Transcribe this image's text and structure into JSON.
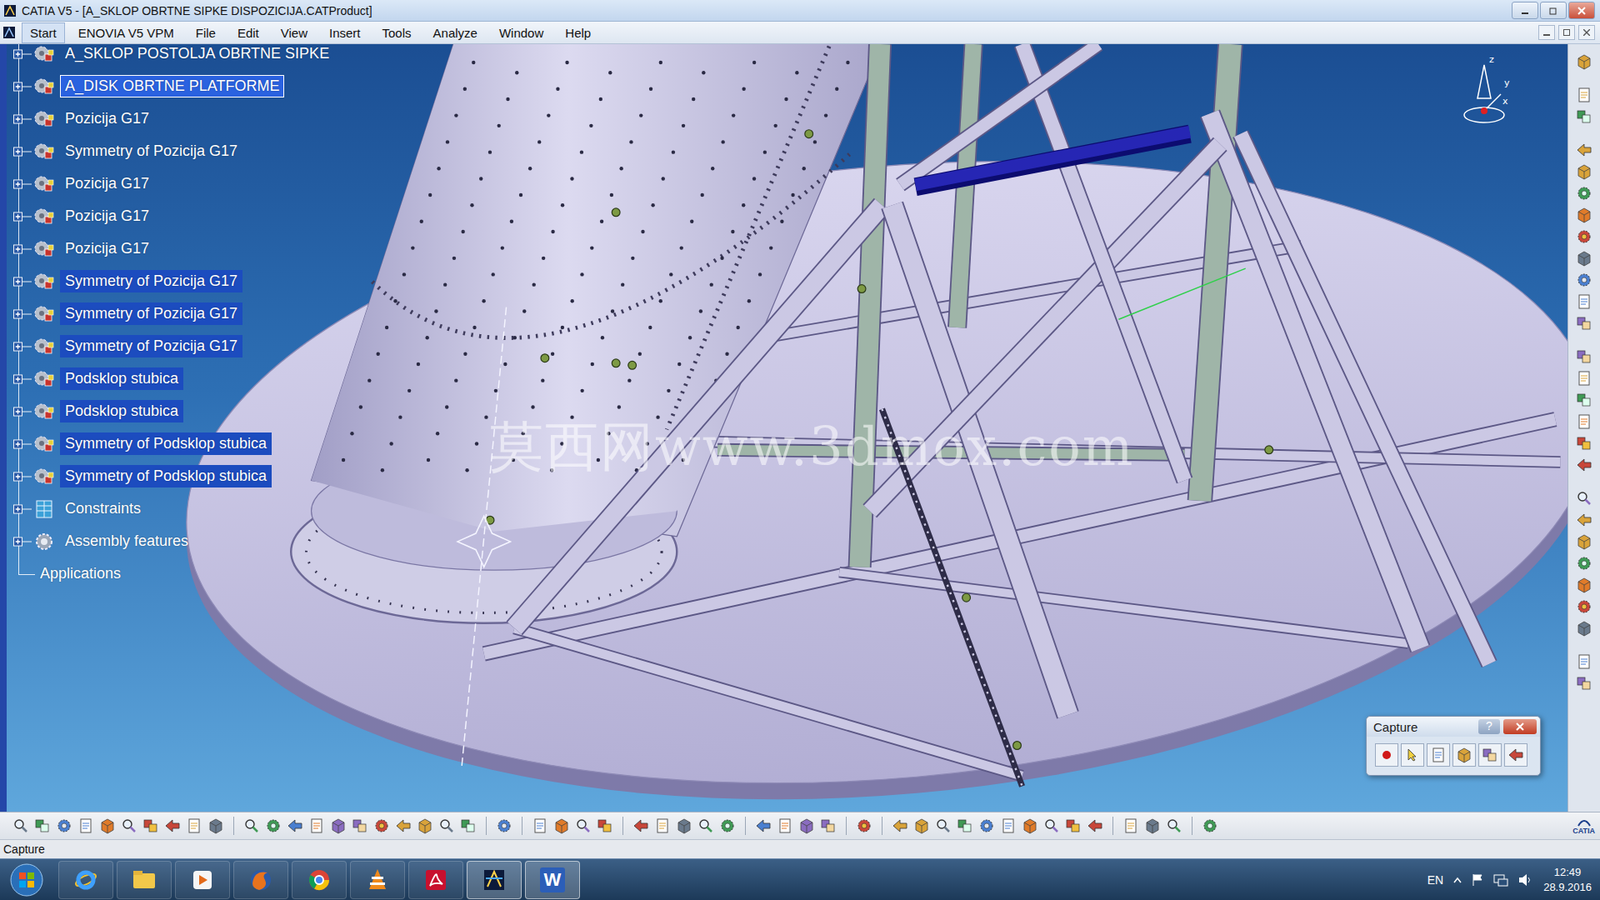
{
  "window": {
    "title": "CATIA V5 - [A_SKLOP OBRTNE SIPKE DISPOZICIJA.CATProduct]"
  },
  "menu": [
    {
      "label": "Start",
      "selected": true
    },
    {
      "label": "ENOVIA V5 VPM",
      "selected": false
    },
    {
      "label": "File",
      "selected": false
    },
    {
      "label": "Edit",
      "selected": false
    },
    {
      "label": "View",
      "selected": false
    },
    {
      "label": "Insert",
      "selected": false
    },
    {
      "label": "Tools",
      "selected": false
    },
    {
      "label": "Analyze",
      "selected": false
    },
    {
      "label": "Window",
      "selected": false
    },
    {
      "label": "Help",
      "selected": false
    }
  ],
  "tree": {
    "items": [
      {
        "label": "A_SKLOP POSTOLJA OBRTNE SIPKE",
        "kind": "product",
        "expandable": true,
        "selected": false,
        "focused": false
      },
      {
        "label": "A_DISK OBRTNE PLATFORME",
        "kind": "product",
        "expandable": true,
        "selected": true,
        "focused": true
      },
      {
        "label": "Pozicija G17",
        "kind": "product",
        "expandable": true,
        "selected": false,
        "focused": false
      },
      {
        "label": "Symmetry of Pozicija G17",
        "kind": "product",
        "expandable": true,
        "selected": false,
        "focused": false
      },
      {
        "label": "Pozicija G17",
        "kind": "product",
        "expandable": true,
        "selected": false,
        "focused": false
      },
      {
        "label": "Pozicija G17",
        "kind": "product",
        "expandable": true,
        "selected": false,
        "focused": false
      },
      {
        "label": "Pozicija G17",
        "kind": "product",
        "expandable": true,
        "selected": false,
        "focused": false
      },
      {
        "label": "Symmetry of Pozicija G17",
        "kind": "product",
        "expandable": true,
        "selected": true,
        "focused": false
      },
      {
        "label": "Symmetry of Pozicija G17",
        "kind": "product",
        "expandable": true,
        "selected": true,
        "focused": false
      },
      {
        "label": "Symmetry of Pozicija G17",
        "kind": "product",
        "expandable": true,
        "selected": true,
        "focused": false
      },
      {
        "label": "Podsklop stubica",
        "kind": "product",
        "expandable": true,
        "selected": true,
        "focused": false
      },
      {
        "label": "Podsklop stubica",
        "kind": "product",
        "expandable": true,
        "selected": true,
        "focused": false
      },
      {
        "label": "Symmetry of Podsklop stubica",
        "kind": "product",
        "expandable": true,
        "selected": true,
        "focused": false
      },
      {
        "label": "Symmetry of Podsklop stubica",
        "kind": "product",
        "expandable": true,
        "selected": true,
        "focused": false
      },
      {
        "label": "Constraints",
        "kind": "constraints",
        "expandable": true,
        "selected": false,
        "focused": false
      },
      {
        "label": "Assembly features",
        "kind": "features",
        "expandable": true,
        "selected": false,
        "focused": false
      },
      {
        "label": "Applications",
        "kind": "applications",
        "expandable": false,
        "selected": false,
        "focused": false
      }
    ]
  },
  "watermark": "莫西网www.3dmox.com",
  "compass": {
    "axes": [
      "z",
      "y",
      "x"
    ]
  },
  "capture_dialog": {
    "title": "Capture",
    "help": "?"
  },
  "status_bar": "Capture",
  "brand": "CATIA",
  "taskbar": {
    "word_glyph": "W",
    "language": "EN",
    "time": "12:49",
    "date": "28.9.2016"
  }
}
